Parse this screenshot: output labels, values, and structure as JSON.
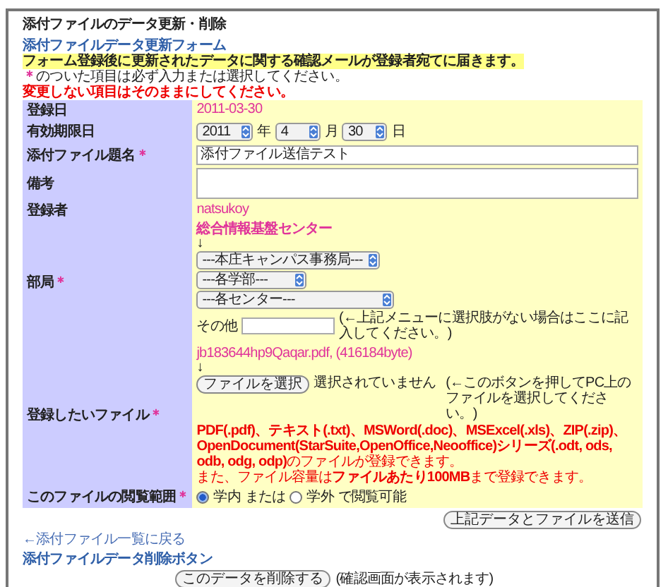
{
  "page_title": "添付ファイルのデータ更新・削除",
  "form_title": "添付ファイルデータ更新フォーム",
  "notice_highlight": "フォーム登録後に更新されたデータに関する確認メールが登録者宛てに届きます。",
  "required_note": {
    "mark": "＊",
    "text": "のついた項目は必ず入力または選択してください。"
  },
  "warning": "変更しない項目はそのままにしてください。",
  "rows": [
    {
      "kind": "text",
      "label": "登録日",
      "value": "2011-03-30"
    },
    {
      "kind": "date",
      "label": "有効期限日",
      "year": "2011",
      "year_unit": "年",
      "month": "4",
      "month_unit": "月",
      "day": "30",
      "day_unit": "日"
    },
    {
      "kind": "input",
      "label": "添付ファイル題名",
      "mark": "＊",
      "value": "添付ファイル送信テスト"
    },
    {
      "kind": "textarea",
      "label": "備考"
    },
    {
      "kind": "text",
      "label": "登録者",
      "value": "natsukoy"
    },
    {
      "kind": "dept",
      "label": "部局",
      "mark": "＊",
      "current": "総合情報基盤センター",
      "arrow": "↓",
      "selects": [
        "---本庄キャンパス事務局---",
        "---各学部---",
        "---各センター---"
      ],
      "other_label": "その他",
      "other_note": "(←上記メニューに選択肢がない場合はここに記入してください。)"
    },
    {
      "kind": "file",
      "label": "登録したいファイル",
      "mark": "＊",
      "current": "jb183644hp9Qaqar.pdf, (416184byte)",
      "arrow": "↓",
      "button": "ファイルを選択",
      "status": "選択されていません",
      "note": "(←このボタンを押してPC上のファイルを選択してください。)",
      "formats": "**PDF(.pdf)、テキスト(.txt)、MSWord(.doc)、MSExcel(.xls)、ZIP(.zip)、OpenDocument(StarSuite,OpenOffice,Neooffice)シリーズ(.odt, ods, odb, odg, odp)**のファイルが登録できます。",
      "size_note": "また、ファイル容量は**ファイルあたり100MB**まで登録できます。"
    },
    {
      "kind": "radio",
      "label": "このファイルの閲覧範囲",
      "mark": "＊",
      "options": [
        {
          "label": "学内",
          "selected": true
        },
        {
          "label": "学外",
          "selected": false
        }
      ],
      "joiner": "または",
      "suffix": "で閲覧可能"
    }
  ],
  "submit_button": "上記データとファイルを送信",
  "back_link": "←添付ファイル一覧に戻る",
  "delete_title": "添付ファイルデータ削除ボタン",
  "delete_button": "このデータを削除する",
  "delete_note": "(確認画面が表示されます)"
}
